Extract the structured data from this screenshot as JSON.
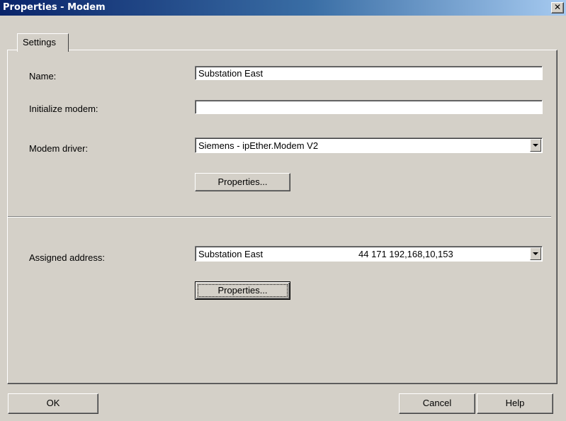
{
  "window": {
    "title": "Properties - Modem",
    "close_icon": "close-icon"
  },
  "tabs": [
    {
      "label": "Settings",
      "active": true
    }
  ],
  "fields": {
    "name_label": "Name:",
    "name_value": "Substation East",
    "init_label": "Initialize modem:",
    "init_value": "",
    "driver_label": "Modem driver:",
    "driver_value": "Siemens - ipEther.Modem V2",
    "driver_properties": "Properties...",
    "address_label": "Assigned address:",
    "address_value_name": "Substation East",
    "address_value_numbers": "44  171  192,168,10,153",
    "address_properties": "Properties..."
  },
  "buttons": {
    "ok": "OK",
    "cancel": "Cancel",
    "help": "Help"
  },
  "icons": {
    "dropdown": "chevron-down-icon"
  }
}
